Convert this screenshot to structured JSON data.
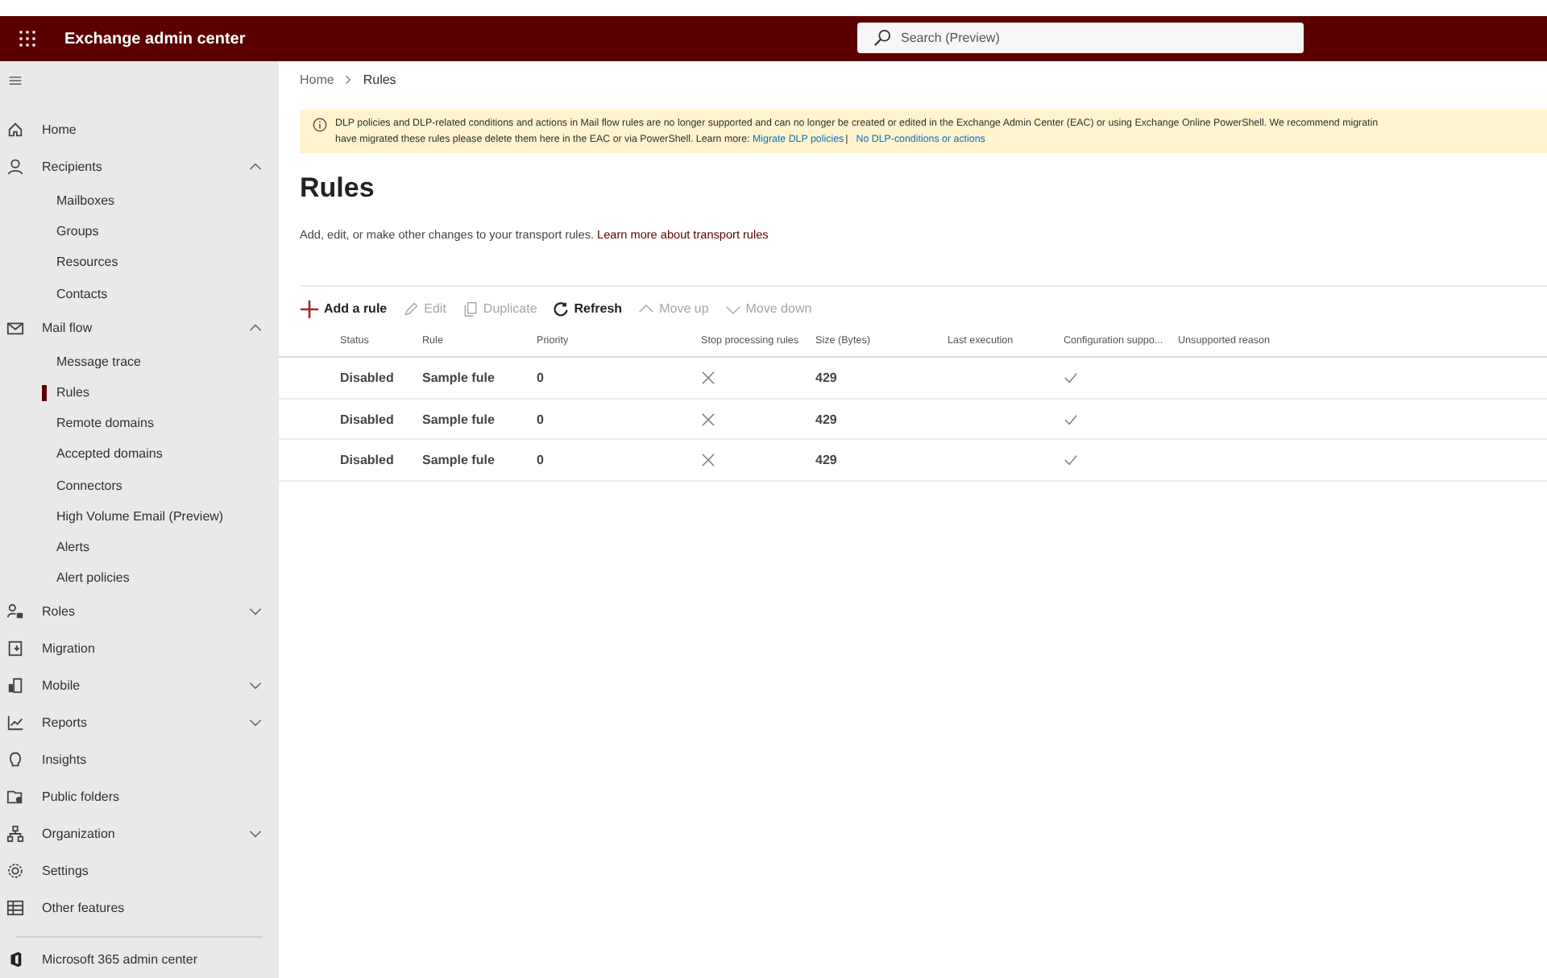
{
  "header": {
    "app_title": "Exchange admin center",
    "search": {
      "placeholder": "Search (Preview)"
    }
  },
  "sidebar": {
    "items": [
      {
        "label": "Home",
        "kind": "nav"
      },
      {
        "label": "Recipients",
        "kind": "group",
        "expanded": true,
        "children": [
          {
            "label": "Mailboxes",
            "selected": false
          },
          {
            "label": "Groups",
            "selected": false
          },
          {
            "label": "Resources",
            "selected": false
          },
          {
            "label": "Contacts",
            "selected": false
          }
        ]
      },
      {
        "label": "Mail flow",
        "kind": "group",
        "expanded": true,
        "children": [
          {
            "label": "Message trace",
            "selected": false
          },
          {
            "label": "Rules",
            "selected": true
          },
          {
            "label": "Remote domains",
            "selected": false
          },
          {
            "label": "Accepted domains",
            "selected": false
          },
          {
            "label": "Connectors",
            "selected": false
          },
          {
            "label": "High Volume Email (Preview)",
            "selected": false
          },
          {
            "label": "Alerts",
            "selected": false
          },
          {
            "label": "Alert policies",
            "selected": false
          }
        ]
      },
      {
        "label": "Roles",
        "kind": "group",
        "expanded": false
      },
      {
        "label": "Migration",
        "kind": "nav"
      },
      {
        "label": "Mobile",
        "kind": "group",
        "expanded": false
      },
      {
        "label": "Reports",
        "kind": "group",
        "expanded": false
      },
      {
        "label": "Insights",
        "kind": "nav"
      },
      {
        "label": "Public folders",
        "kind": "nav"
      },
      {
        "label": "Organization",
        "kind": "group",
        "expanded": false
      },
      {
        "label": "Settings",
        "kind": "nav"
      },
      {
        "label": "Other features",
        "kind": "nav"
      }
    ],
    "footer_item": {
      "label": "Microsoft 365 admin center"
    }
  },
  "breadcrumb": [
    {
      "label": "Home"
    },
    {
      "label": "Rules"
    }
  ],
  "banner": {
    "line_1": "DLP policies and DLP-related conditions and actions in Mail flow rules are no longer supported and can no longer be created or edited in the Exchange Admin Center (EAC) or using Exchange Online PowerShell. We recommend migratin",
    "line_2": "have migrated these rules please delete them here in the EAC or via PowerShell. Learn more: ",
    "links": [
      "Migrate DLP policies",
      "No DLP-conditions or actions"
    ],
    "separator": "|"
  },
  "page_title": "Rules",
  "description": {
    "text": "Add, edit, or make other changes to your transport rules. ",
    "link": "Learn more about transport rules"
  },
  "toolbar": [
    {
      "label": "Add a rule",
      "kind": "add",
      "disabled": false
    },
    {
      "label": "Edit",
      "kind": "edit",
      "disabled": true
    },
    {
      "label": "Duplicate",
      "kind": "duplicate",
      "disabled": true
    },
    {
      "label": "Refresh",
      "kind": "refresh",
      "disabled": false
    },
    {
      "label": "Move up",
      "kind": "up",
      "disabled": true
    },
    {
      "label": "Move down",
      "kind": "down",
      "disabled": true
    }
  ],
  "table": {
    "columns": [
      "Status",
      "Rule",
      "Priority",
      "Stop processing rules",
      "Size (Bytes)",
      "Last execution",
      "Configuration suppo...",
      "Unsupported reason"
    ],
    "rows": [
      {
        "status": "Disabled",
        "rule": "Sample fule",
        "priority": "0",
        "stop_processing": false,
        "size": "429",
        "configuration_supported": true
      },
      {
        "status": "Disabled",
        "rule": "Sample fule",
        "priority": "0",
        "stop_processing": false,
        "size": "429",
        "configuration_supported": true
      },
      {
        "status": "Disabled",
        "rule": "Sample fule",
        "priority": "0",
        "stop_processing": false,
        "size": "429",
        "configuration_supported": true
      }
    ]
  }
}
